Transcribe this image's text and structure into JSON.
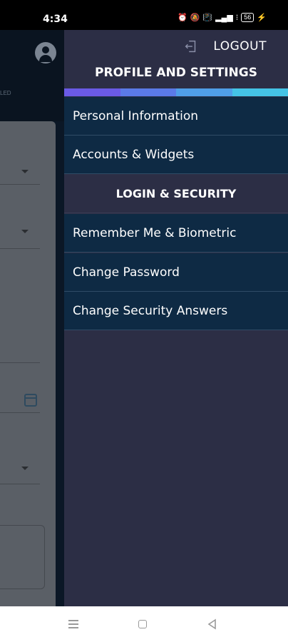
{
  "status_bar": {
    "time": "4:34",
    "icons": [
      "alarm-icon",
      "mute-icon",
      "vibrate-icon",
      "signal-icon",
      "wifi-icon",
      "battery-icon",
      "charging-icon"
    ],
    "battery_level": "56"
  },
  "background_app": {
    "header_fragment": "LED"
  },
  "drawer": {
    "logout_label": "LOGOUT",
    "title": "PROFILE AND SETTINGS",
    "gradient_colors": [
      "#6a5ae6",
      "#5b7ae8",
      "#4f9ee8",
      "#44c3e6"
    ],
    "items": [
      {
        "label": "Personal Information"
      },
      {
        "label": "Accounts & Widgets"
      }
    ],
    "section_title": "LOGIN & SECURITY",
    "security_items": [
      {
        "label": "Remember Me & Biometric"
      },
      {
        "label": "Change Password"
      },
      {
        "label": "Change Security Answers"
      }
    ]
  },
  "colors": {
    "drawer_bg": "#2c2e45",
    "item_bg": "#0e2a44",
    "item_divider": "#2f4b66"
  }
}
